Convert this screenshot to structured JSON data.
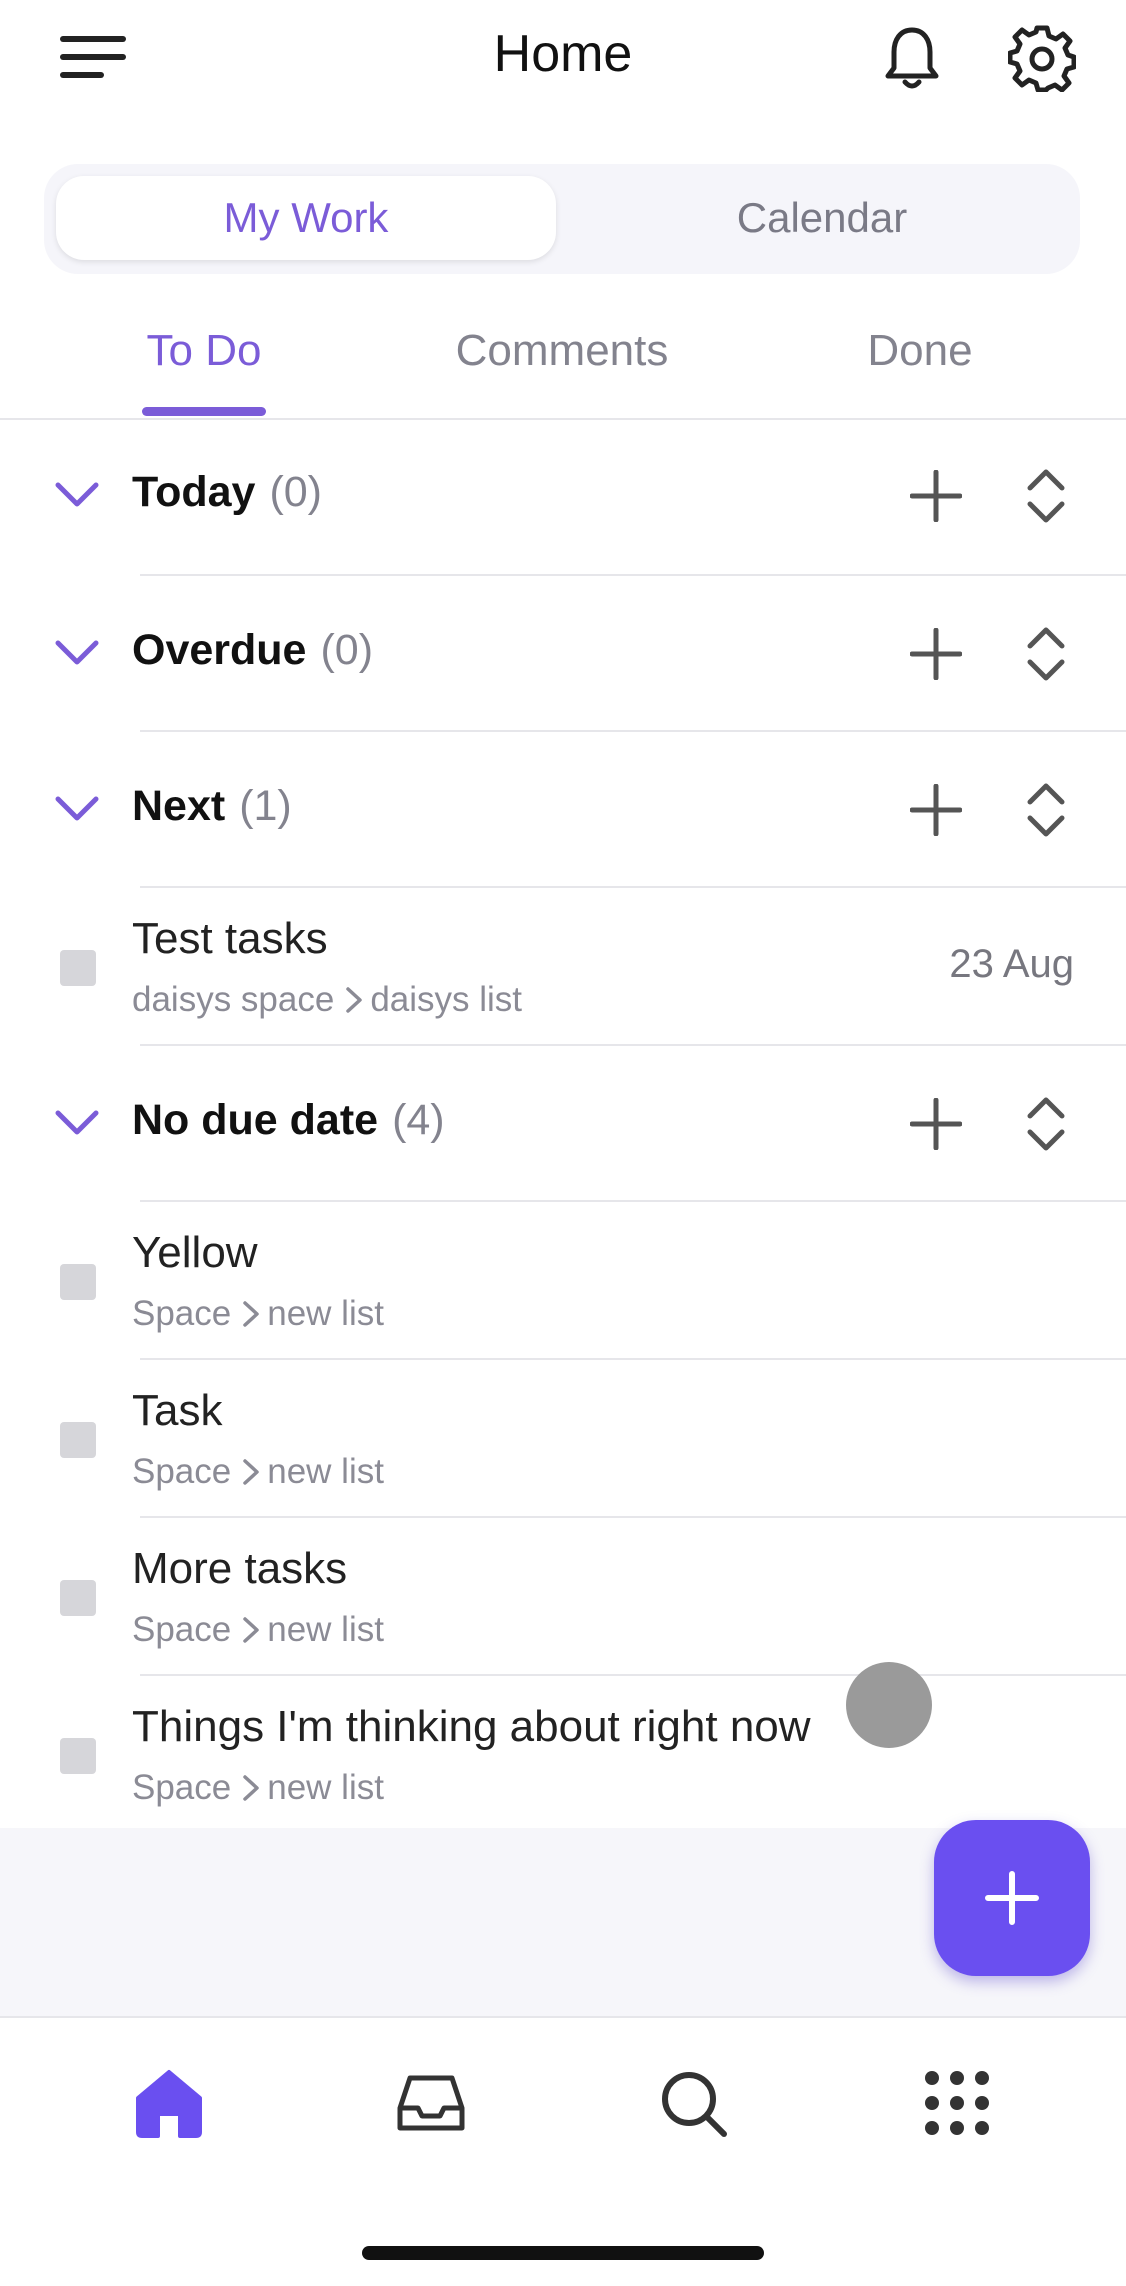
{
  "header": {
    "title": "Home"
  },
  "segment": {
    "my_work": "My Work",
    "calendar": "Calendar"
  },
  "tabs": [
    {
      "label": "To Do"
    },
    {
      "label": "Comments"
    },
    {
      "label": "Done"
    }
  ],
  "sections": [
    {
      "title": "Today",
      "count": "(0)"
    },
    {
      "title": "Overdue",
      "count": "(0)"
    },
    {
      "title": "Next",
      "count": "(1)"
    },
    {
      "title": "No due date",
      "count": "(4)"
    }
  ],
  "next_tasks": [
    {
      "title": "Test tasks",
      "space": "daisys space",
      "list": "daisys list",
      "date": "23 Aug"
    }
  ],
  "no_due_tasks": [
    {
      "title": "Yellow",
      "space": "Space",
      "list": "new list"
    },
    {
      "title": "Task",
      "space": "Space",
      "list": "new list"
    },
    {
      "title": "More tasks",
      "space": "Space",
      "list": "new list"
    },
    {
      "title": "Things I'm thinking about right now",
      "space": "Space",
      "list": "new list"
    }
  ],
  "colors": {
    "accent": "#7b5cd8",
    "fab": "#6a4ff0"
  },
  "nav": {
    "icons": [
      "home-icon",
      "inbox-icon",
      "search-icon",
      "apps-grid-icon"
    ]
  }
}
